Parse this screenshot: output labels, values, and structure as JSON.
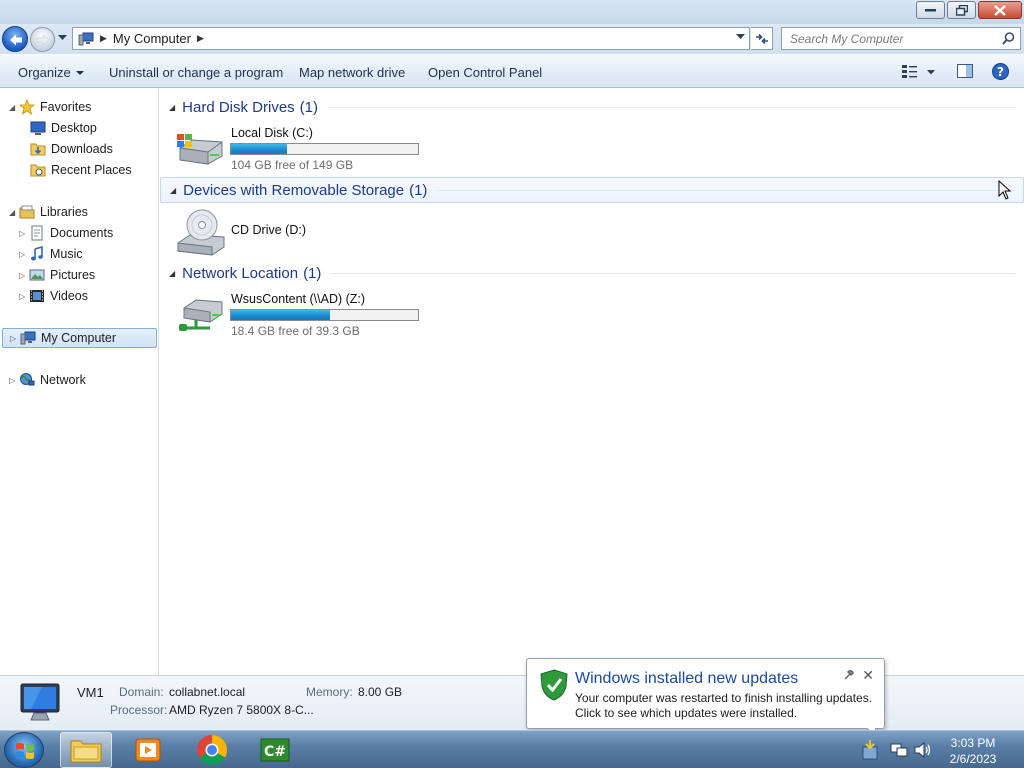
{
  "window": {
    "title_buttons": [
      "minimize",
      "restore",
      "close"
    ]
  },
  "address": {
    "crumb": "My Computer",
    "search_placeholder": "Search My Computer"
  },
  "toolbar": {
    "organize": "Organize",
    "uninstall": "Uninstall or change a program",
    "map_drive": "Map network drive",
    "control_panel": "Open Control Panel"
  },
  "nav": {
    "favorites": "Favorites",
    "desktop": "Desktop",
    "downloads": "Downloads",
    "recent_places": "Recent Places",
    "libraries": "Libraries",
    "documents": "Documents",
    "music": "Music",
    "pictures": "Pictures",
    "videos": "Videos",
    "my_computer": "My Computer",
    "network": "Network"
  },
  "groups": {
    "hdd": {
      "title": "Hard Disk Drives",
      "count": "(1)",
      "drive": {
        "name": "Local Disk (C:)",
        "free_text": "104 GB free of 149 GB",
        "used_fraction": 0.3
      }
    },
    "removable": {
      "title": "Devices with Removable Storage",
      "count": "(1)",
      "drive": {
        "name": "CD Drive (D:)"
      }
    },
    "network": {
      "title": "Network Location",
      "count": "(1)",
      "drive": {
        "name": "WsusContent (\\\\AD) (Z:)",
        "free_text": "18.4 GB free of 39.3 GB",
        "used_fraction": 0.53
      }
    }
  },
  "details": {
    "computer_name": "VM1",
    "domain_label": "Domain:",
    "domain_value": "collabnet.local",
    "memory_label": "Memory:",
    "memory_value": "8.00 GB",
    "processor_label": "Processor:",
    "processor_value": "AMD Ryzen 7 5800X 8-C..."
  },
  "notification": {
    "title": "Windows installed new updates",
    "line1": "Your computer was restarted to finish installing updates.",
    "line2": "Click to see which updates were installed."
  },
  "taskbar": {
    "time": "3:03 PM",
    "date": "2/6/2023",
    "apps": [
      "windows-explorer",
      "media-player",
      "chrome",
      "csharp-editor"
    ]
  },
  "colors": {
    "accent_blue": "#1b4aa0",
    "bar_fill": "#1d8ccf",
    "taskbar": "#5a7fa6"
  }
}
